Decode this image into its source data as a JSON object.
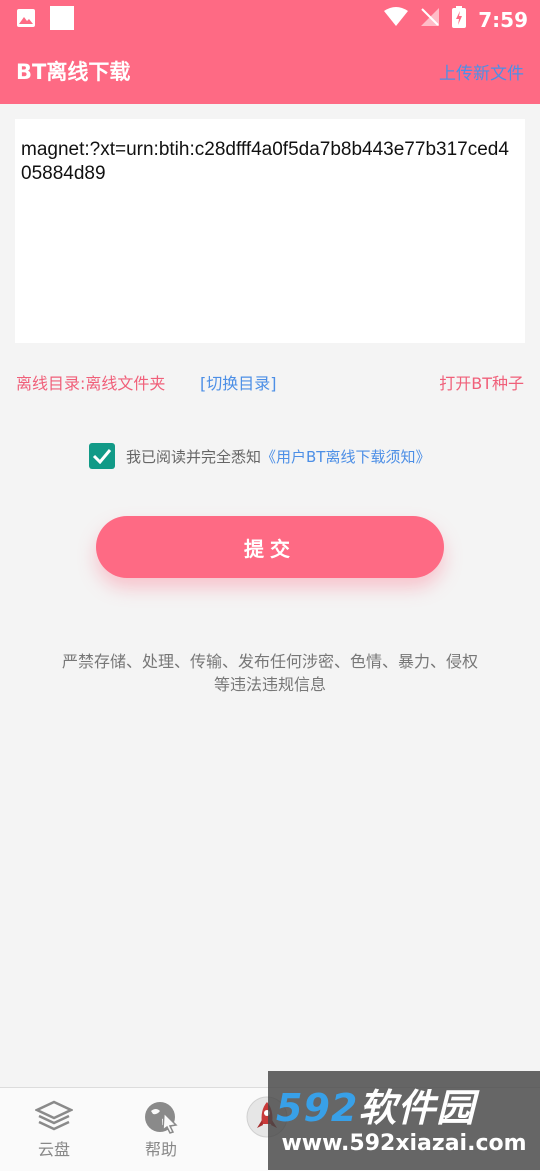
{
  "status_bar": {
    "time": "7:59"
  },
  "app_bar": {
    "title": "BT离线下载",
    "upload_link": "上传新文件"
  },
  "magnet": {
    "value": "magnet:?xt=urn:btih:c28dfff4a0f5da7b8b443e77b317ced405884d89"
  },
  "directory": {
    "label": "离线目录:离线文件夹",
    "switch_label": "[切换目录]",
    "open_seed_label": "打开BT种子"
  },
  "agreement": {
    "checked": true,
    "text": "我已阅读并完全悉知",
    "link": "《用户BT离线下载须知》"
  },
  "submit": {
    "label": "提交"
  },
  "warning": {
    "line1": "严禁存储、处理、传输、发布任何涉密、色情、暴力、侵权",
    "line2": "等违法违规信息"
  },
  "bottom_nav": {
    "items": [
      {
        "label": "云盘",
        "icon": "layers-icon"
      },
      {
        "label": "帮助",
        "icon": "help-globe-icon"
      },
      {
        "label": "",
        "icon": "rocket-icon"
      }
    ]
  },
  "watermark": {
    "brand_num": "592",
    "brand_text": "软件园",
    "url": "www.592xiazai.com"
  },
  "colors": {
    "primary": "#fe6a84",
    "link": "#4d8fe6",
    "checkbox": "#119a87"
  }
}
